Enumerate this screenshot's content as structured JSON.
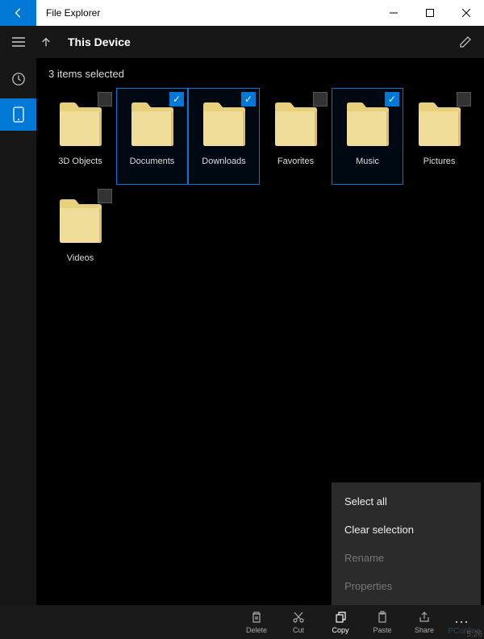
{
  "titlebar": {
    "title": "File Explorer"
  },
  "header": {
    "title": "This Device"
  },
  "selection": {
    "text": "3 items selected"
  },
  "folders": [
    {
      "name": "3D Objects",
      "selected": false
    },
    {
      "name": "Documents",
      "selected": true
    },
    {
      "name": "Downloads",
      "selected": true
    },
    {
      "name": "Favorites",
      "selected": false
    },
    {
      "name": "Music",
      "selected": true
    },
    {
      "name": "Pictures",
      "selected": false
    },
    {
      "name": "Videos",
      "selected": false
    }
  ],
  "context_menu": {
    "items": [
      {
        "label": "Select all",
        "disabled": false
      },
      {
        "label": "Clear selection",
        "disabled": false
      },
      {
        "label": "Rename",
        "disabled": true
      },
      {
        "label": "Properties",
        "disabled": true
      }
    ]
  },
  "toolbar": {
    "items": [
      {
        "label": "Delete",
        "icon": "trash-icon",
        "active": false
      },
      {
        "label": "Cut",
        "icon": "cut-icon",
        "active": false
      },
      {
        "label": "Copy",
        "icon": "copy-icon",
        "active": true
      },
      {
        "label": "Paste",
        "icon": "paste-icon",
        "active": false
      },
      {
        "label": "Share",
        "icon": "share-icon",
        "active": false
      }
    ]
  },
  "watermark": "PConline",
  "clock": "5:26"
}
